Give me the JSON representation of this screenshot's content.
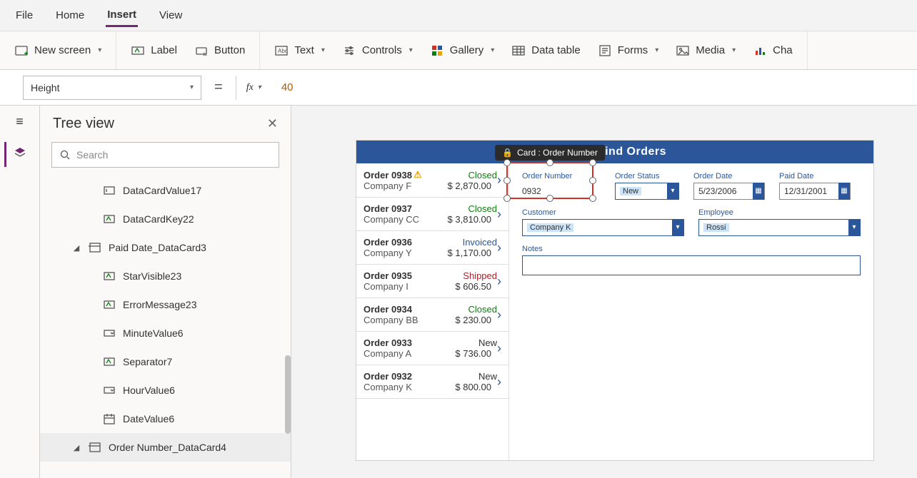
{
  "menu": {
    "file": "File",
    "home": "Home",
    "insert": "Insert",
    "view": "View"
  },
  "ribbon": {
    "new_screen": "New screen",
    "label": "Label",
    "button": "Button",
    "text": "Text",
    "controls": "Controls",
    "gallery": "Gallery",
    "data_table": "Data table",
    "forms": "Forms",
    "media": "Media",
    "charts": "Cha"
  },
  "formula": {
    "prop": "Height",
    "fx": "fx",
    "value": "40"
  },
  "tree": {
    "title": "Tree view",
    "search_placeholder": "Search",
    "items": [
      {
        "label": "DataCardValue17",
        "icon": "textbox",
        "depth": 2
      },
      {
        "label": "DataCardKey22",
        "icon": "label",
        "depth": 2
      },
      {
        "label": "Paid Date_DataCard3",
        "icon": "card",
        "depth": 1,
        "tw": "◢"
      },
      {
        "label": "StarVisible23",
        "icon": "label",
        "depth": 2
      },
      {
        "label": "ErrorMessage23",
        "icon": "label",
        "depth": 2
      },
      {
        "label": "MinuteValue6",
        "icon": "dropdown",
        "depth": 2
      },
      {
        "label": "Separator7",
        "icon": "label",
        "depth": 2
      },
      {
        "label": "HourValue6",
        "icon": "dropdown",
        "depth": 2
      },
      {
        "label": "DateValue6",
        "icon": "date",
        "depth": 2
      },
      {
        "label": "Order Number_DataCard4",
        "icon": "card",
        "depth": 1,
        "tw": "◢",
        "sel": true
      }
    ]
  },
  "app": {
    "title": "Northwind Orders",
    "gallery": [
      {
        "order": "Order 0938",
        "company": "Company F",
        "status": "Closed",
        "status_cls": "closed",
        "amount": "$ 2,870.00",
        "warn": true
      },
      {
        "order": "Order 0937",
        "company": "Company CC",
        "status": "Closed",
        "status_cls": "closed",
        "amount": "$ 3,810.00"
      },
      {
        "order": "Order 0936",
        "company": "Company Y",
        "status": "Invoiced",
        "status_cls": "invoiced",
        "amount": "$ 1,170.00"
      },
      {
        "order": "Order 0935",
        "company": "Company I",
        "status": "Shipped",
        "status_cls": "shipped",
        "amount": "$ 606.50"
      },
      {
        "order": "Order 0934",
        "company": "Company BB",
        "status": "Closed",
        "status_cls": "closed",
        "amount": "$ 230.00"
      },
      {
        "order": "Order 0933",
        "company": "Company A",
        "status": "New",
        "status_cls": "new",
        "amount": "$ 736.00"
      },
      {
        "order": "Order 0932",
        "company": "Company K",
        "status": "New",
        "status_cls": "new",
        "amount": "$ 800.00"
      }
    ],
    "form": {
      "order_number": {
        "label": "Order Number",
        "value": "0932"
      },
      "order_status": {
        "label": "Order Status",
        "value": "New"
      },
      "order_date": {
        "label": "Order Date",
        "value": "5/23/2006"
      },
      "paid_date": {
        "label": "Paid Date",
        "value": "12/31/2001"
      },
      "customer": {
        "label": "Customer",
        "value": "Company K"
      },
      "employee": {
        "label": "Employee",
        "value": "Rossi"
      },
      "notes": {
        "label": "Notes",
        "value": ""
      }
    },
    "sel_label": "Card : Order Number"
  }
}
